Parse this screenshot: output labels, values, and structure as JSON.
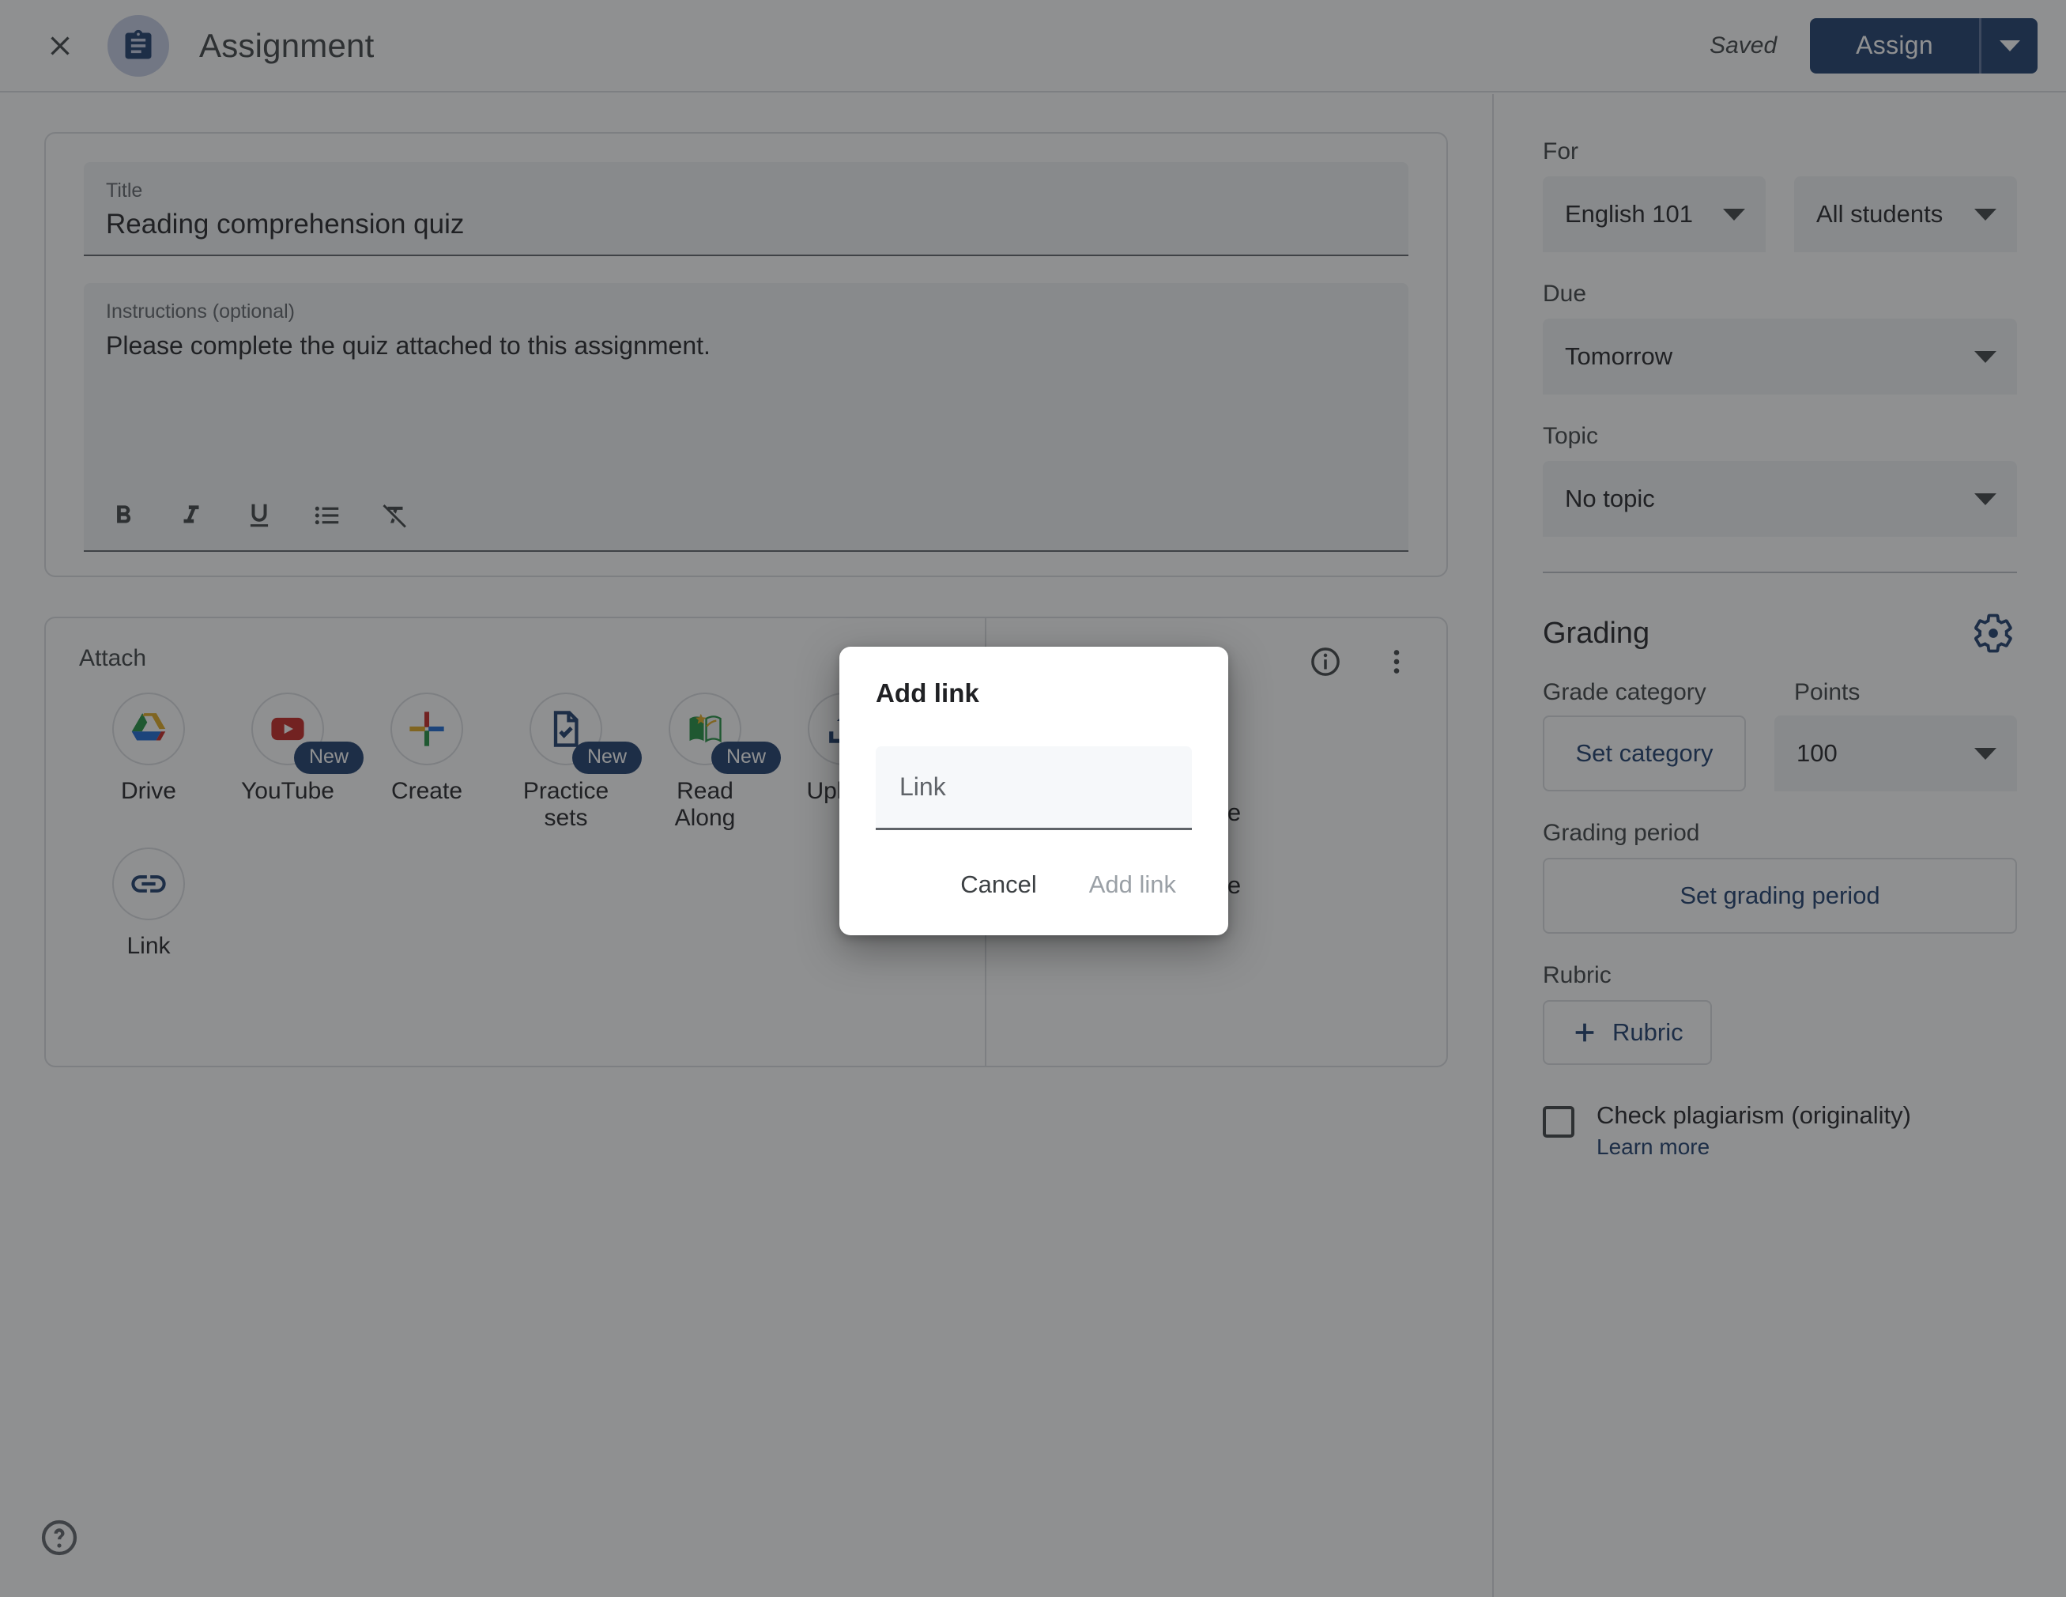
{
  "topbar": {
    "close_icon": "close-icon",
    "app_icon": "assignment-clipboard-icon",
    "title": "Assignment",
    "saved_label": "Saved",
    "assign_label": "Assign",
    "assign_dropdown_icon": "chevron-down-icon"
  },
  "detail": {
    "title_label": "Title",
    "title_value": "Reading comprehension quiz",
    "instructions_label": "Instructions (optional)",
    "instructions_value": "Please complete the quiz attached to this assignment.",
    "format_buttons": [
      {
        "name": "bold-icon",
        "label": "B"
      },
      {
        "name": "italic-icon",
        "label": "I"
      },
      {
        "name": "underline-icon",
        "label": "U"
      },
      {
        "name": "bulleted-list-icon",
        "label": "List"
      },
      {
        "name": "clear-formatting-icon",
        "label": "Clear formatting"
      }
    ]
  },
  "attach": {
    "heading": "Attach",
    "items": [
      {
        "label": "Drive",
        "icon": "google-drive-icon",
        "badge": null
      },
      {
        "label": "YouTube",
        "icon": "youtube-icon",
        "badge": "New"
      },
      {
        "label": "Create",
        "icon": "create-plus-icon",
        "badge": null
      },
      {
        "label": "Practice sets",
        "icon": "practice-sets-icon",
        "badge": "New"
      },
      {
        "label": "Read Along",
        "icon": "read-along-icon",
        "badge": "New"
      },
      {
        "label": "Upload",
        "icon": "upload-icon",
        "badge": null
      },
      {
        "label": "Link",
        "icon": "link-icon",
        "badge": null
      }
    ],
    "info_icon": "info-icon",
    "more_icon": "more-vert-icon",
    "addons": [
      {
        "label": "Add-on name",
        "icon": "person-avatar-icon"
      },
      {
        "label": "Add-on name",
        "icon": "person-avatar-icon"
      }
    ]
  },
  "help": {
    "icon": "help-circle-icon"
  },
  "settings": {
    "for_label": "For",
    "class_value": "English 101",
    "students_value": "All students",
    "due_label": "Due",
    "due_value": "Tomorrow",
    "topic_label": "Topic",
    "topic_value": "No topic",
    "grading_label": "Grading",
    "grading_settings_icon": "gear-icon",
    "grade_category_label": "Grade category",
    "grade_category_value": "Set category",
    "points_label": "Points",
    "points_value": "100",
    "grading_period_label": "Grading period",
    "grading_period_value": "Set grading period",
    "rubric_label": "Rubric",
    "rubric_button": "Rubric",
    "rubric_add_icon": "plus-icon",
    "plagiarism_label": "Check plagiarism (originality)",
    "learn_more": "Learn more"
  },
  "modal": {
    "title": "Add link",
    "field_placeholder": "Link",
    "field_value": "",
    "cancel_label": "Cancel",
    "submit_label": "Add link"
  },
  "colors": {
    "accent": "#1a3a6b",
    "surface": "#ffffff",
    "field": "#f1f3f4",
    "border": "#dadce0",
    "text": "#202124",
    "muted": "#5f6368",
    "scrim": "rgba(32,33,36,0.5)"
  }
}
